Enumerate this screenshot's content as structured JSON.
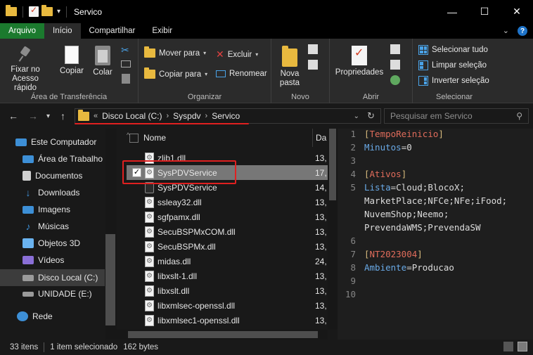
{
  "window": {
    "title": "Servico",
    "controls": {
      "minimize": "—",
      "maximize": "☐",
      "close": "✕"
    }
  },
  "ribbon_tabs": [
    {
      "label": "Arquivo"
    },
    {
      "label": "Início"
    },
    {
      "label": "Compartilhar"
    },
    {
      "label": "Exibir"
    }
  ],
  "ribbon": {
    "clipboard": {
      "pin": "Fixar no\nAcesso rápido",
      "pin_l1": "Fixar no",
      "pin_l2": "Acesso rápido",
      "copy": "Copiar",
      "paste": "Colar",
      "label": "Área de Transferência"
    },
    "organize": {
      "move_to": "Mover para",
      "copy_to": "Copiar para",
      "delete": "Excluir",
      "rename": "Renomear",
      "label": "Organizar"
    },
    "new": {
      "new_folder_l1": "Nova",
      "new_folder_l2": "pasta",
      "label": "Novo"
    },
    "open": {
      "properties": "Propriedades",
      "label": "Abrir"
    },
    "select": {
      "select_all": "Selecionar tudo",
      "clear": "Limpar seleção",
      "invert": "Inverter seleção",
      "label": "Selecionar"
    }
  },
  "address": {
    "prefix": "«",
    "crumbs": [
      "Disco Local (C:)",
      "Syspdv",
      "Servico"
    ],
    "search_placeholder": "Pesquisar em Servico"
  },
  "sidebar": {
    "items": [
      {
        "label": "Este Computador",
        "icon": "computer-icon",
        "color": "#3d8fd6"
      },
      {
        "label": "Área de Trabalho",
        "icon": "desktop-icon",
        "color": "#3d8fd6"
      },
      {
        "label": "Documentos",
        "icon": "documents-icon",
        "color": "#d0d0d0"
      },
      {
        "label": "Downloads",
        "icon": "downloads-icon",
        "color": "#3d8fd6"
      },
      {
        "label": "Imagens",
        "icon": "pictures-icon",
        "color": "#3d8fd6"
      },
      {
        "label": "Músicas",
        "icon": "music-icon",
        "color": "#3d8fd6"
      },
      {
        "label": "Objetos 3D",
        "icon": "objects-3d-icon",
        "color": "#6ab3f0"
      },
      {
        "label": "Vídeos",
        "icon": "videos-icon",
        "color": "#8a6fd6"
      },
      {
        "label": "Disco Local (C:)",
        "icon": "drive-icon",
        "color": "#9a9a9a"
      },
      {
        "label": "UNIDADE (E:)",
        "icon": "usb-drive-icon",
        "color": "#9a9a9a"
      },
      {
        "label": "Rede",
        "icon": "network-icon",
        "color": "#3d8fd6"
      }
    ]
  },
  "file_list": {
    "col_name": "Nome",
    "col_date": "Da",
    "rows": [
      {
        "name": "zlib1.dll",
        "date": "13,"
      },
      {
        "name": "SysPDVService",
        "date": "17,"
      },
      {
        "name": "SysPDVService",
        "date": "14,"
      },
      {
        "name": "ssleay32.dll",
        "date": "13,"
      },
      {
        "name": "sgfpamx.dll",
        "date": "13,"
      },
      {
        "name": "SecuBSPMxCOM.dll",
        "date": "13,"
      },
      {
        "name": "SecuBSPMx.dll",
        "date": "13,"
      },
      {
        "name": "midas.dll",
        "date": "24,"
      },
      {
        "name": "libxslt-1.dll",
        "date": "13,"
      },
      {
        "name": "libxslt.dll",
        "date": "13,"
      },
      {
        "name": "libxmlsec-openssl.dll",
        "date": "13,"
      },
      {
        "name": "libxmlsec1-openssl.dll",
        "date": "13,"
      }
    ]
  },
  "preview": {
    "lines": [
      {
        "n": "1",
        "section": "TempoReinicio"
      },
      {
        "n": "2",
        "key": "Minutos",
        "value": "0"
      },
      {
        "n": "3"
      },
      {
        "n": "4",
        "section": "Ativos"
      },
      {
        "n": "5",
        "key": "Lista",
        "value": "Cloud;BlocoX;"
      },
      {
        "n": "",
        "value": "MarketPlace;NFCe;NFe;iFood;"
      },
      {
        "n": "",
        "value": "NuvemShop;Neemo;"
      },
      {
        "n": "",
        "value": "PrevendaWMS;PrevendaSW"
      },
      {
        "n": "6"
      },
      {
        "n": "7",
        "section": "NT2023004"
      },
      {
        "n": "8",
        "key": "Ambiente",
        "value": "Producao"
      },
      {
        "n": "9"
      },
      {
        "n": "10"
      }
    ]
  },
  "status": {
    "count": "33 itens",
    "selected": "1 item selecionado",
    "size": "162 bytes"
  },
  "colors": {
    "accent_file_tab": "#1b7a2e",
    "annotation_red": "#e02020",
    "section_name": "#e06c5b",
    "key": "#69a9e6"
  }
}
